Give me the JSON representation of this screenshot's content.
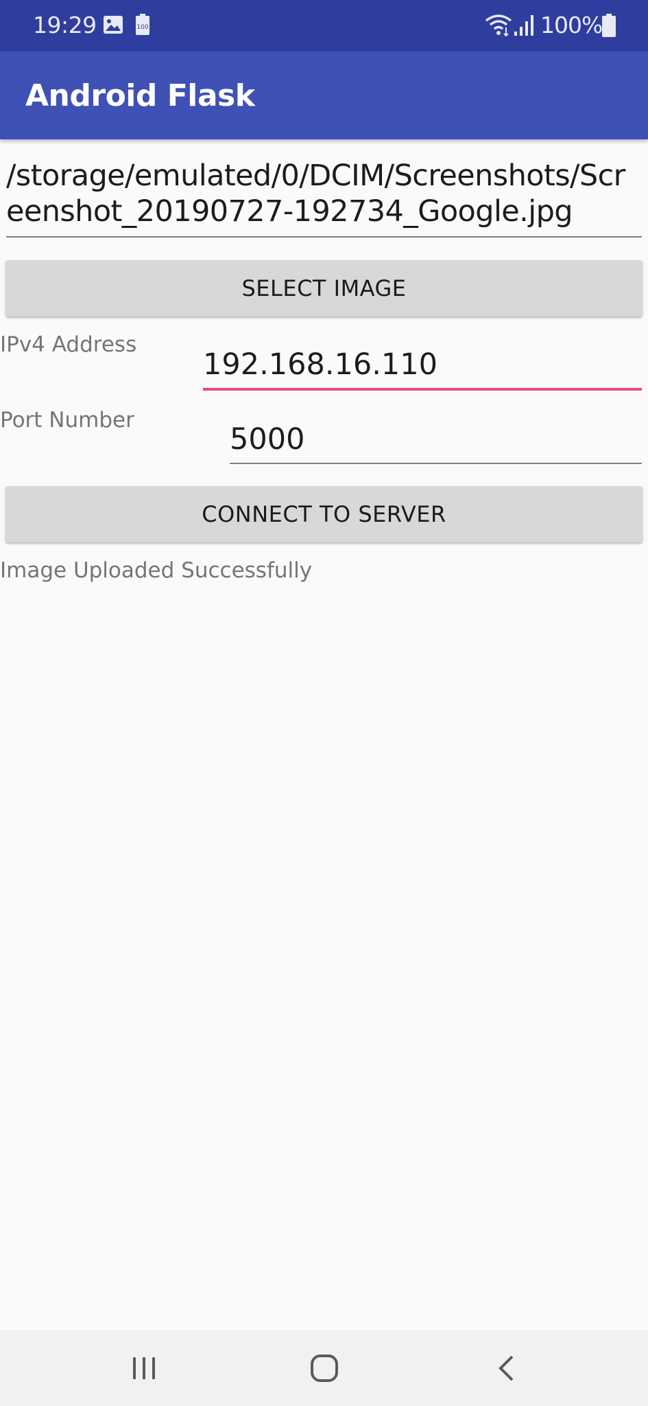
{
  "status_bar": {
    "time": "19:29",
    "battery_level": "100%",
    "icons": [
      "gallery-icon",
      "battery-saver-icon",
      "wifi-icon",
      "signal-icon",
      "battery-icon"
    ]
  },
  "app_bar": {
    "title": "Android Flask"
  },
  "image_path": {
    "value": "/storage/emulated/0/DCIM/Screenshots/Screenshot_20190727-192734_Google.jpg"
  },
  "select_button": {
    "label": "SELECT IMAGE"
  },
  "ip_field": {
    "label": "IPv4 Address",
    "value": "192.168.16.110"
  },
  "port_field": {
    "label": "Port Number",
    "value": "5000"
  },
  "connect_button": {
    "label": "CONNECT TO SERVER"
  },
  "status_message": {
    "text": "Image Uploaded Successfully"
  },
  "nav_bar": {
    "icons": [
      "recent-apps-icon",
      "home-icon",
      "back-icon"
    ]
  },
  "colors": {
    "status_bar": "#2f3e9e",
    "app_bar": "#3f51b5",
    "accent": "#e8477f",
    "button": "#d7d8d7",
    "background": "#fafafa"
  }
}
